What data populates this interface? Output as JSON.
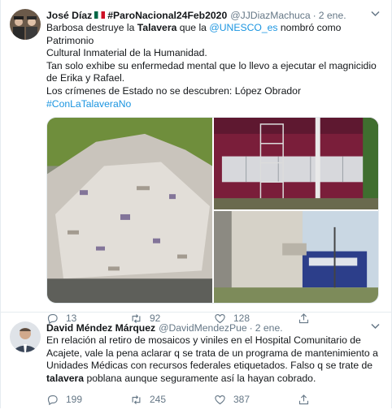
{
  "tweets": [
    {
      "name": "José Díaz",
      "handle_name": "#ParoNacional24Feb2020",
      "handle": "@JJDiazMachuca",
      "date": "2 ene.",
      "body": {
        "l1a": "Barbosa destruye la ",
        "l1b": "Talavera",
        "l1c": " que la ",
        "l1d": "@UNESCO_es",
        "l1e": " nombró como Patrimonio",
        "l2": "Cultural Inmaterial de la Humanidad.",
        "l3": "Tan solo exhibe su enfermedad mental que lo llevo a ejecutar el magnicidio",
        "l4": "de Erika y Rafael.",
        "l5": "Los crímenes de Estado no se descubren: López Obrador",
        "l6": "#ConLaTalaveraNo"
      },
      "replies": "13",
      "retweets": "92",
      "likes": "128"
    },
    {
      "name": "David Méndez Márquez",
      "handle": "@DavidMendezPue",
      "date": "2 ene.",
      "body": {
        "l1": "En relación al retiro de mosaicos y viniles en el Hospital Comunitario de",
        "l2": "Acajete, vale la pena aclarar q se trata de un programa de mantenimiento a",
        "l3": "Unidades Médicas con recursos federales etiquetados. Falso q se trate de",
        "l4a": "talavera",
        "l4b": " poblana aunque seguramente así la hayan cobrado."
      },
      "replies": "199",
      "retweets": "245",
      "likes": "387"
    }
  ],
  "colors": {
    "link": "#1b95e0",
    "muted": "#657786",
    "border": "#e6ecf0"
  },
  "icons": [
    "reply-icon",
    "retweet-icon",
    "like-icon",
    "share-icon",
    "caret-down-icon",
    "mexico-flag-icon"
  ]
}
